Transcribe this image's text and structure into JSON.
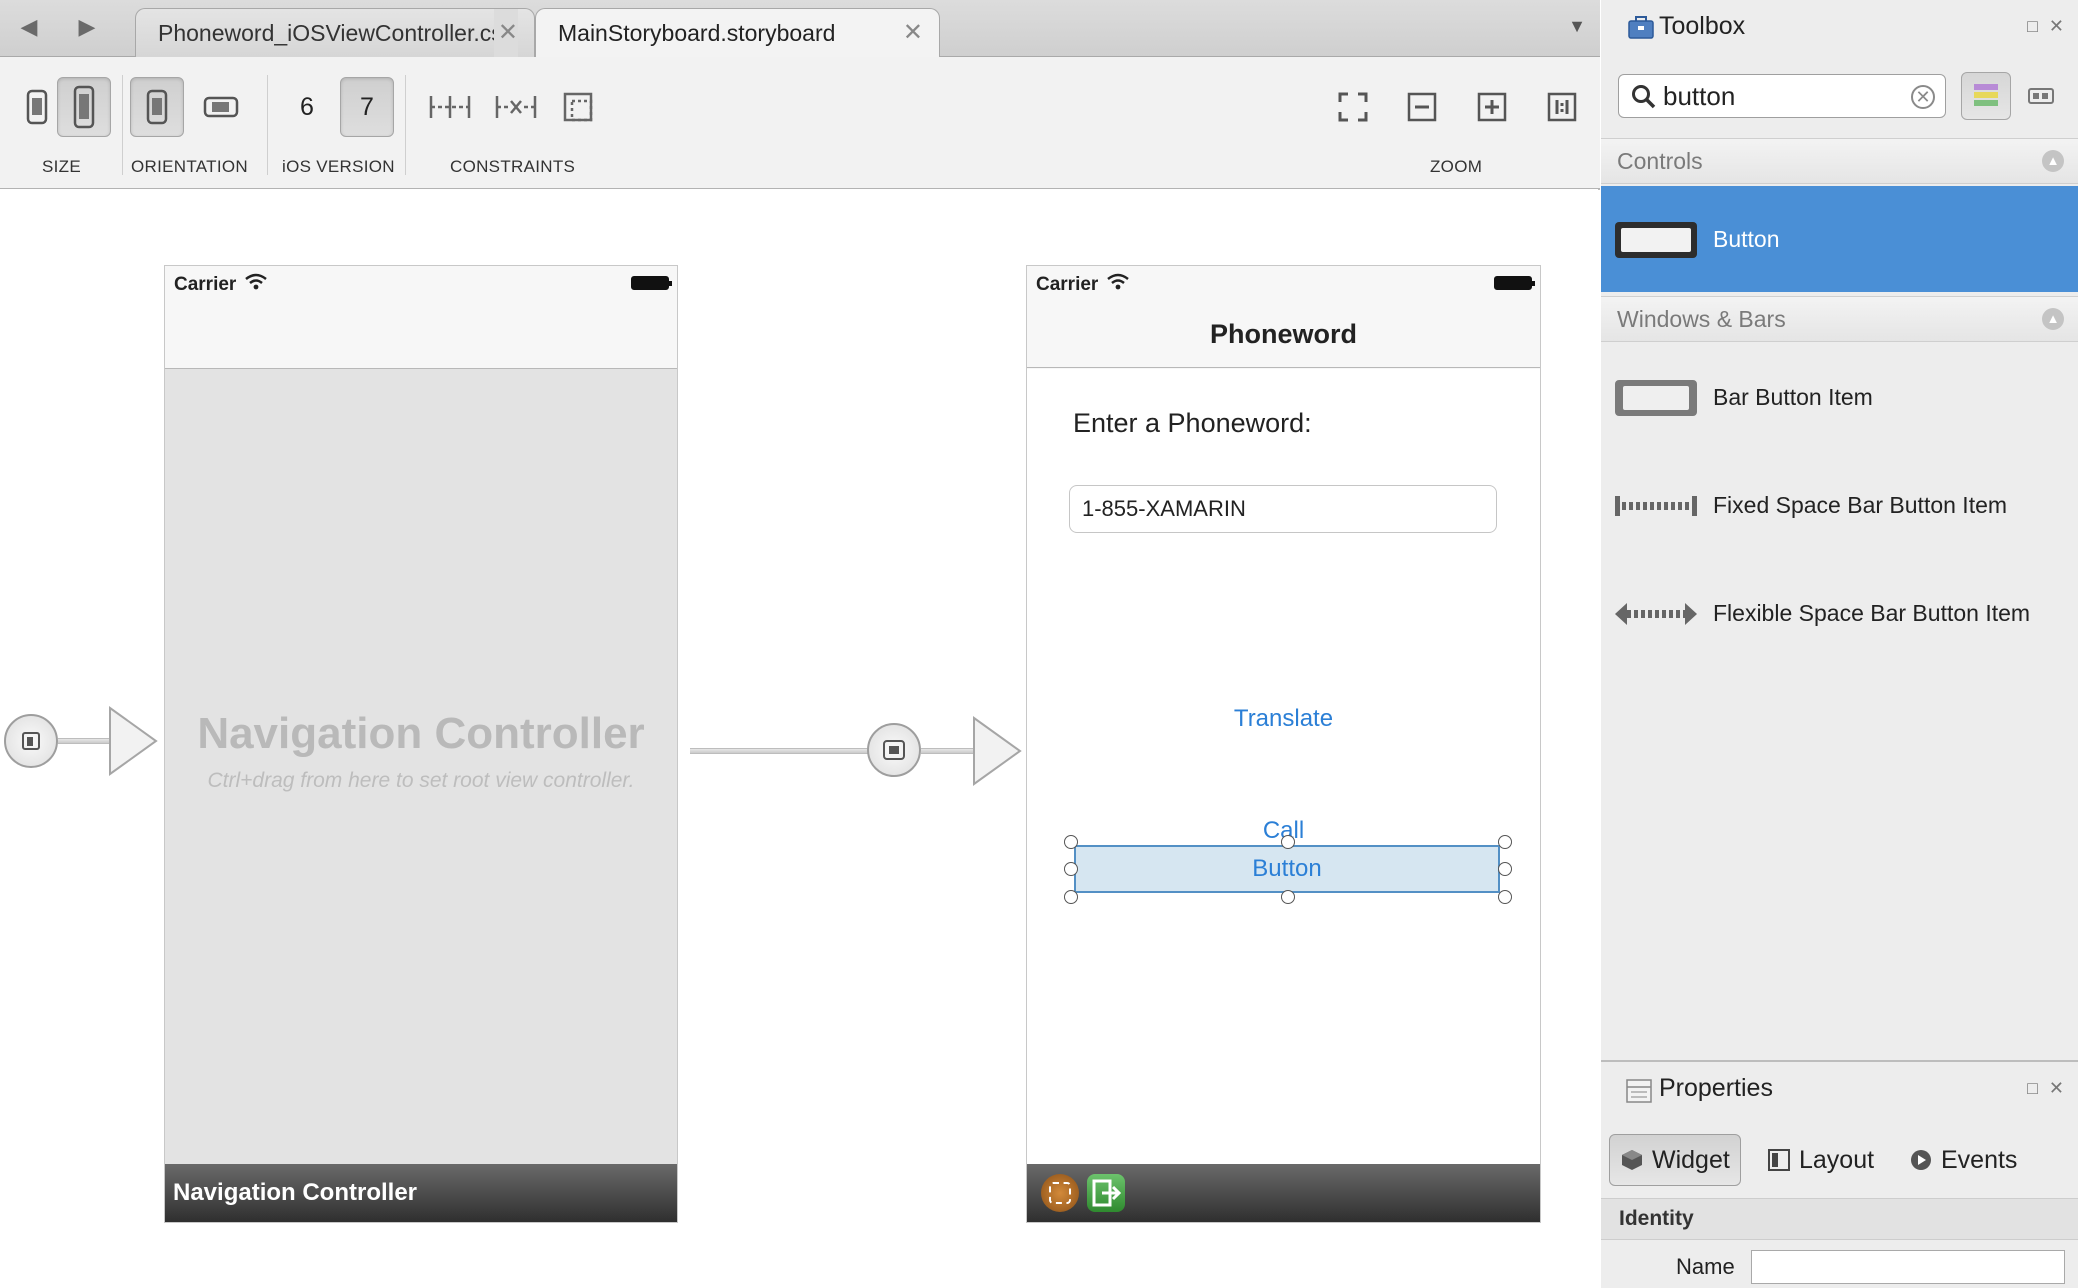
{
  "tabs": [
    {
      "label": "Phoneword_iOSViewController.cs"
    },
    {
      "label": "MainStoryboard.storyboard"
    }
  ],
  "toolbar": {
    "size_label": "SIZE",
    "orientation_label": "ORIENTATION",
    "ios_version_label": "iOS VERSION",
    "ios6": "6",
    "ios7": "7",
    "constraints_label": "CONSTRAINTS",
    "zoom_label": "ZOOM"
  },
  "nav_scene": {
    "carrier": "Carrier",
    "placeholder_title": "Navigation Controller",
    "placeholder_hint": "Ctrl+drag from here to set root view controller.",
    "footer_label": "Navigation Controller"
  },
  "phoneword_scene": {
    "carrier": "Carrier",
    "nav_title": "Phoneword",
    "prompt_label": "Enter a Phoneword:",
    "phone_field_value": "1-855-XAMARIN",
    "translate_label": "Translate",
    "call_label": "Call",
    "selected_button_label": "Button"
  },
  "toolbox": {
    "title": "Toolbox",
    "search_value": "button",
    "categories": [
      {
        "name": "Controls",
        "items": [
          {
            "label": "Button",
            "selected": true
          }
        ]
      },
      {
        "name": "Windows & Bars",
        "items": [
          {
            "label": "Bar Button Item"
          },
          {
            "label": "Fixed Space Bar Button Item"
          },
          {
            "label": "Flexible Space Bar Button Item"
          }
        ]
      }
    ]
  },
  "properties": {
    "title": "Properties",
    "tabs": [
      {
        "label": "Widget",
        "active": true
      },
      {
        "label": "Layout"
      },
      {
        "label": "Events"
      }
    ],
    "section": "Identity",
    "name_label": "Name",
    "name_value": ""
  },
  "colors": {
    "accent_blue": "#4a8fd6",
    "ios_link_blue": "#2b7fd6",
    "selection_fill": "#d6e6f1"
  }
}
